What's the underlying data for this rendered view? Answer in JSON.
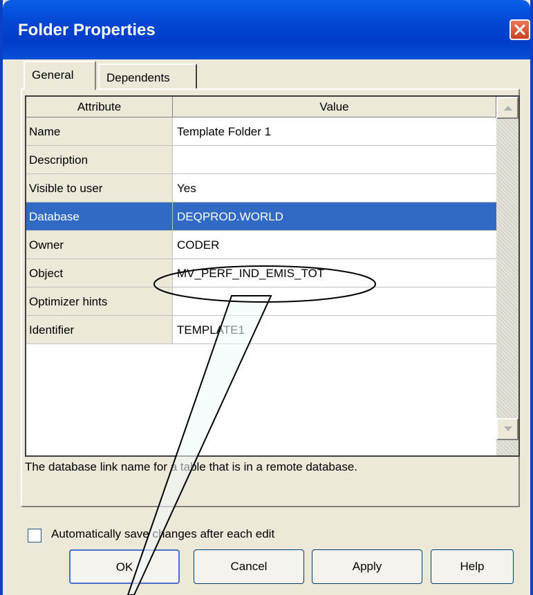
{
  "window": {
    "title": "Folder Properties"
  },
  "tabs": [
    {
      "label": "General",
      "active": true
    },
    {
      "label": "Dependents",
      "active": false
    }
  ],
  "grid": {
    "columns": [
      "Attribute",
      "Value"
    ],
    "rows": [
      {
        "attribute": "Name",
        "value": "Template Folder 1"
      },
      {
        "attribute": "Description",
        "value": ""
      },
      {
        "attribute": "Visible to user",
        "value": "Yes"
      },
      {
        "attribute": "Database",
        "value": "DEQPROD.WORLD",
        "selected": true
      },
      {
        "attribute": "Owner",
        "value": "CODER"
      },
      {
        "attribute": "Object",
        "value": "MV_PERF_IND_EMIS_TOT"
      },
      {
        "attribute": "Optimizer hints",
        "value": ""
      },
      {
        "attribute": "Identifier",
        "value": "TEMPLATE1"
      }
    ]
  },
  "description": "The database link name for a table that is in a remote database.",
  "auto_save": {
    "label": "Automatically save changes after each edit",
    "checked": false
  },
  "buttons": {
    "ok": "OK",
    "cancel": "Cancel",
    "apply": "Apply",
    "help": "Help"
  },
  "icons": {
    "close": "close-icon",
    "scroll_up": "scroll-up-arrow-icon",
    "scroll_down": "scroll-down-arrow-icon"
  },
  "colors": {
    "titlebar": "#0046d5",
    "selection": "#316ac5",
    "dialog_bg": "#ece9d8",
    "close_button": "#d6542e"
  }
}
